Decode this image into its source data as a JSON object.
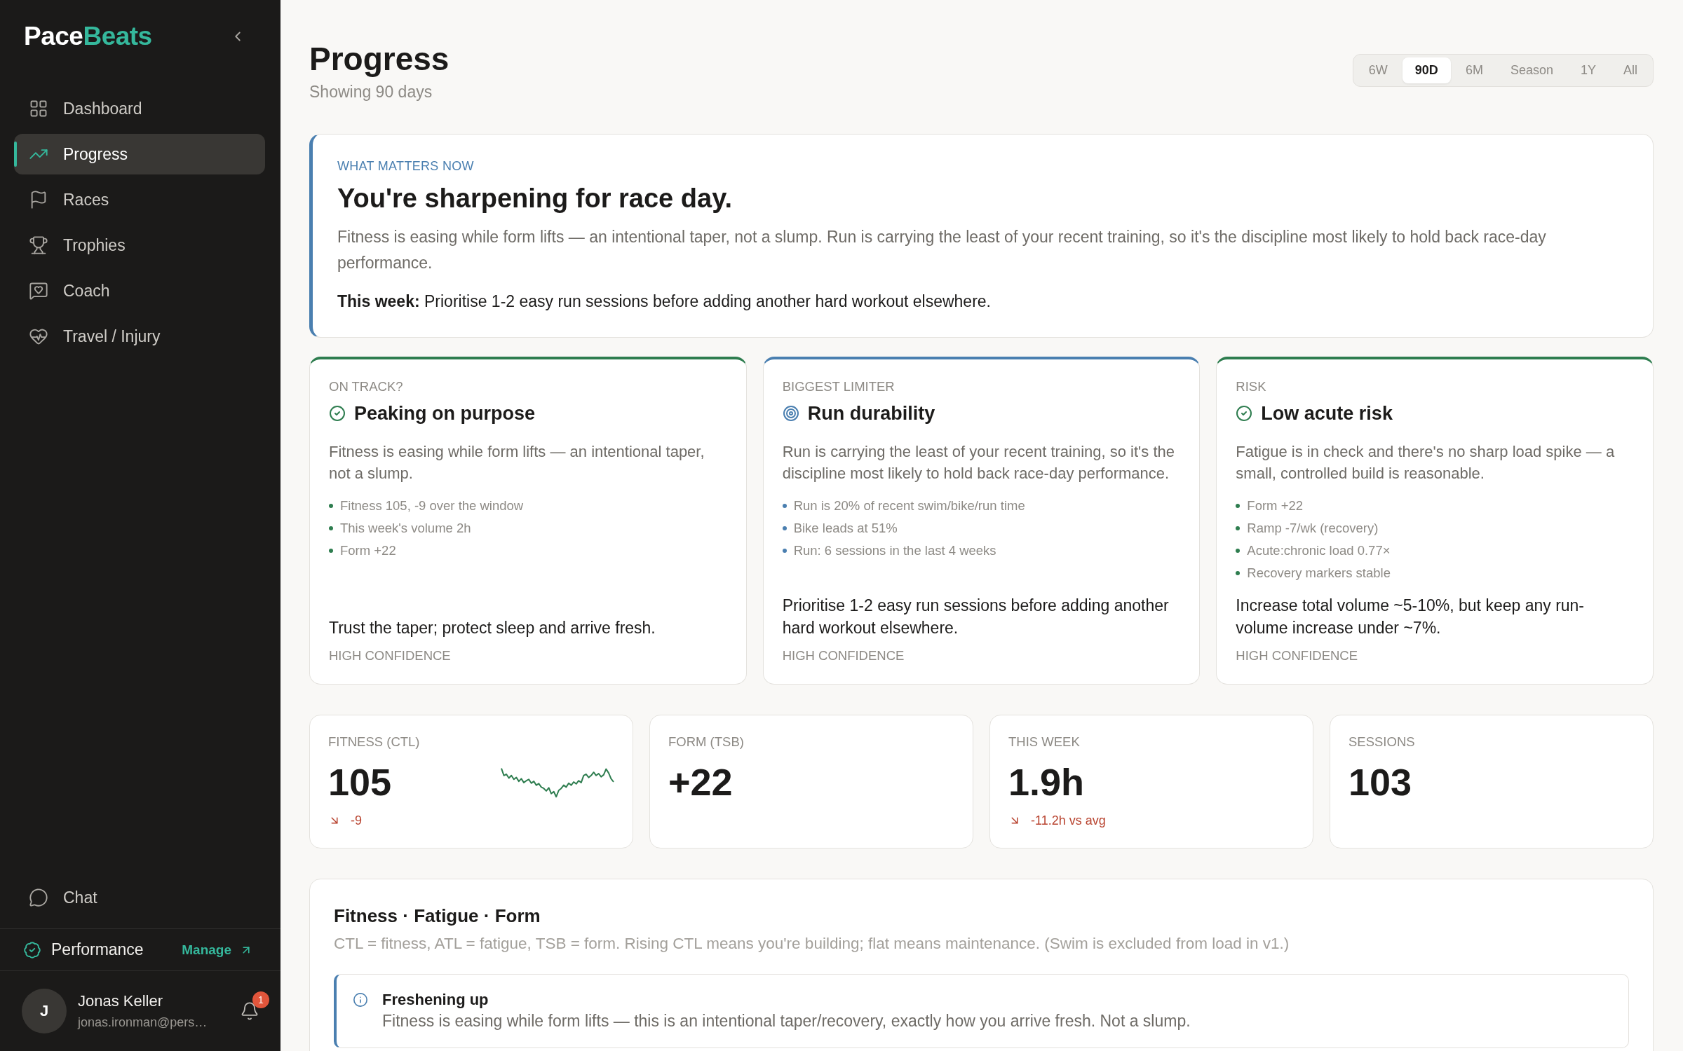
{
  "sidebar": {
    "logo": {
      "text": "Pace",
      "accent": "Beats"
    },
    "nav": [
      {
        "label": "Dashboard",
        "selected": false
      },
      {
        "label": "Progress",
        "selected": true
      },
      {
        "label": "Races",
        "selected": false
      },
      {
        "label": "Trophies",
        "selected": false
      },
      {
        "label": "Coach",
        "selected": false
      },
      {
        "label": "Travel / Injury",
        "selected": false
      }
    ],
    "chat": {
      "label": "Chat"
    },
    "plan": {
      "label": "Performance",
      "link": "Manage"
    },
    "user": {
      "initial": "J",
      "name": "Jonas Keller",
      "email": "jonas.ironman@pers…",
      "notifications": "1"
    }
  },
  "header": {
    "title": "Progress",
    "subtitle": "Showing 90 days",
    "ranges": [
      {
        "label": "6W",
        "selected": false
      },
      {
        "label": "90D",
        "selected": true
      },
      {
        "label": "6M",
        "selected": false
      },
      {
        "label": "Season",
        "selected": false
      },
      {
        "label": "1Y",
        "selected": false
      },
      {
        "label": "All",
        "selected": false
      }
    ]
  },
  "summary": {
    "label": "WHAT MATTERS NOW",
    "heading": "You're sharpening for race day.",
    "body": "Fitness is easing while form lifts — an intentional taper, not a slump. Run is carrying the least of your recent training, so it's the discipline most likely to hold back race-day performance.",
    "this_week": "**This week:** Prioritise 1-2 easy run sessions before adding another hard workout elsewhere."
  },
  "cards": [
    {
      "label": "ON TRACK?",
      "title": "Peaking on purpose",
      "color": "#2e7d4f",
      "body": "Fitness is easing while form lifts — an intentional taper, not a slump.",
      "points": [
        "Fitness 105, -9 over the window",
        "This week's volume 2h",
        "Form +22"
      ],
      "action": "Trust the taper; protect sleep and arrive fresh.",
      "confidence": "HIGH CONFIDENCE"
    },
    {
      "label": "BIGGEST LIMITER",
      "title": "Run durability",
      "color": "#4a7fb0",
      "body": "Run is carrying the least of your recent training, so it's the discipline most likely to hold back race-day performance.",
      "points": [
        "Run is 20% of recent swim/bike/run time",
        "Bike leads at 51%",
        "Run: 6 sessions in the last 4 weeks"
      ],
      "action": "Prioritise 1-2 easy run sessions before adding another hard workout elsewhere.",
      "confidence": "HIGH CONFIDENCE"
    },
    {
      "label": "RISK",
      "title": "Low acute risk",
      "color": "#2e7d4f",
      "body": "Fatigue is in check and there's no sharp load spike — a small, controlled build is reasonable.",
      "points": [
        "Form +22",
        "Ramp -7/wk (recovery)",
        "Acute:chronic load 0.77×",
        "Recovery markers stable"
      ],
      "action": "Increase total volume ~5-10%, but keep any run-volume increase under ~7%.",
      "confidence": "HIGH CONFIDENCE"
    }
  ],
  "stats": [
    {
      "label": "FITNESS (CTL)",
      "value": "105",
      "delta": "-9",
      "falling": true,
      "sparkline": true
    },
    {
      "label": "FORM (TSB)",
      "value": "+22",
      "sparkline": false
    },
    {
      "label": "THIS WEEK",
      "value": "1.9h",
      "delta": "-11.2h vs avg",
      "falling": true,
      "sparkline": false
    },
    {
      "label": "SESSIONS",
      "value": "103",
      "sparkline": false
    }
  ],
  "fitness_chart": {
    "title": "Fitness · Fatigue · Form",
    "description": "CTL = fitness, ATL = fatigue, TSB = form. Rising CTL means you're building; flat means maintenance. (Swim is excluded from load in v1.)",
    "callout": {
      "title": "Freshening up",
      "text": "Fitness is easing while form lifts — this is an intentional taper/recovery, exactly how you arrive fresh. Not a slump."
    }
  }
}
